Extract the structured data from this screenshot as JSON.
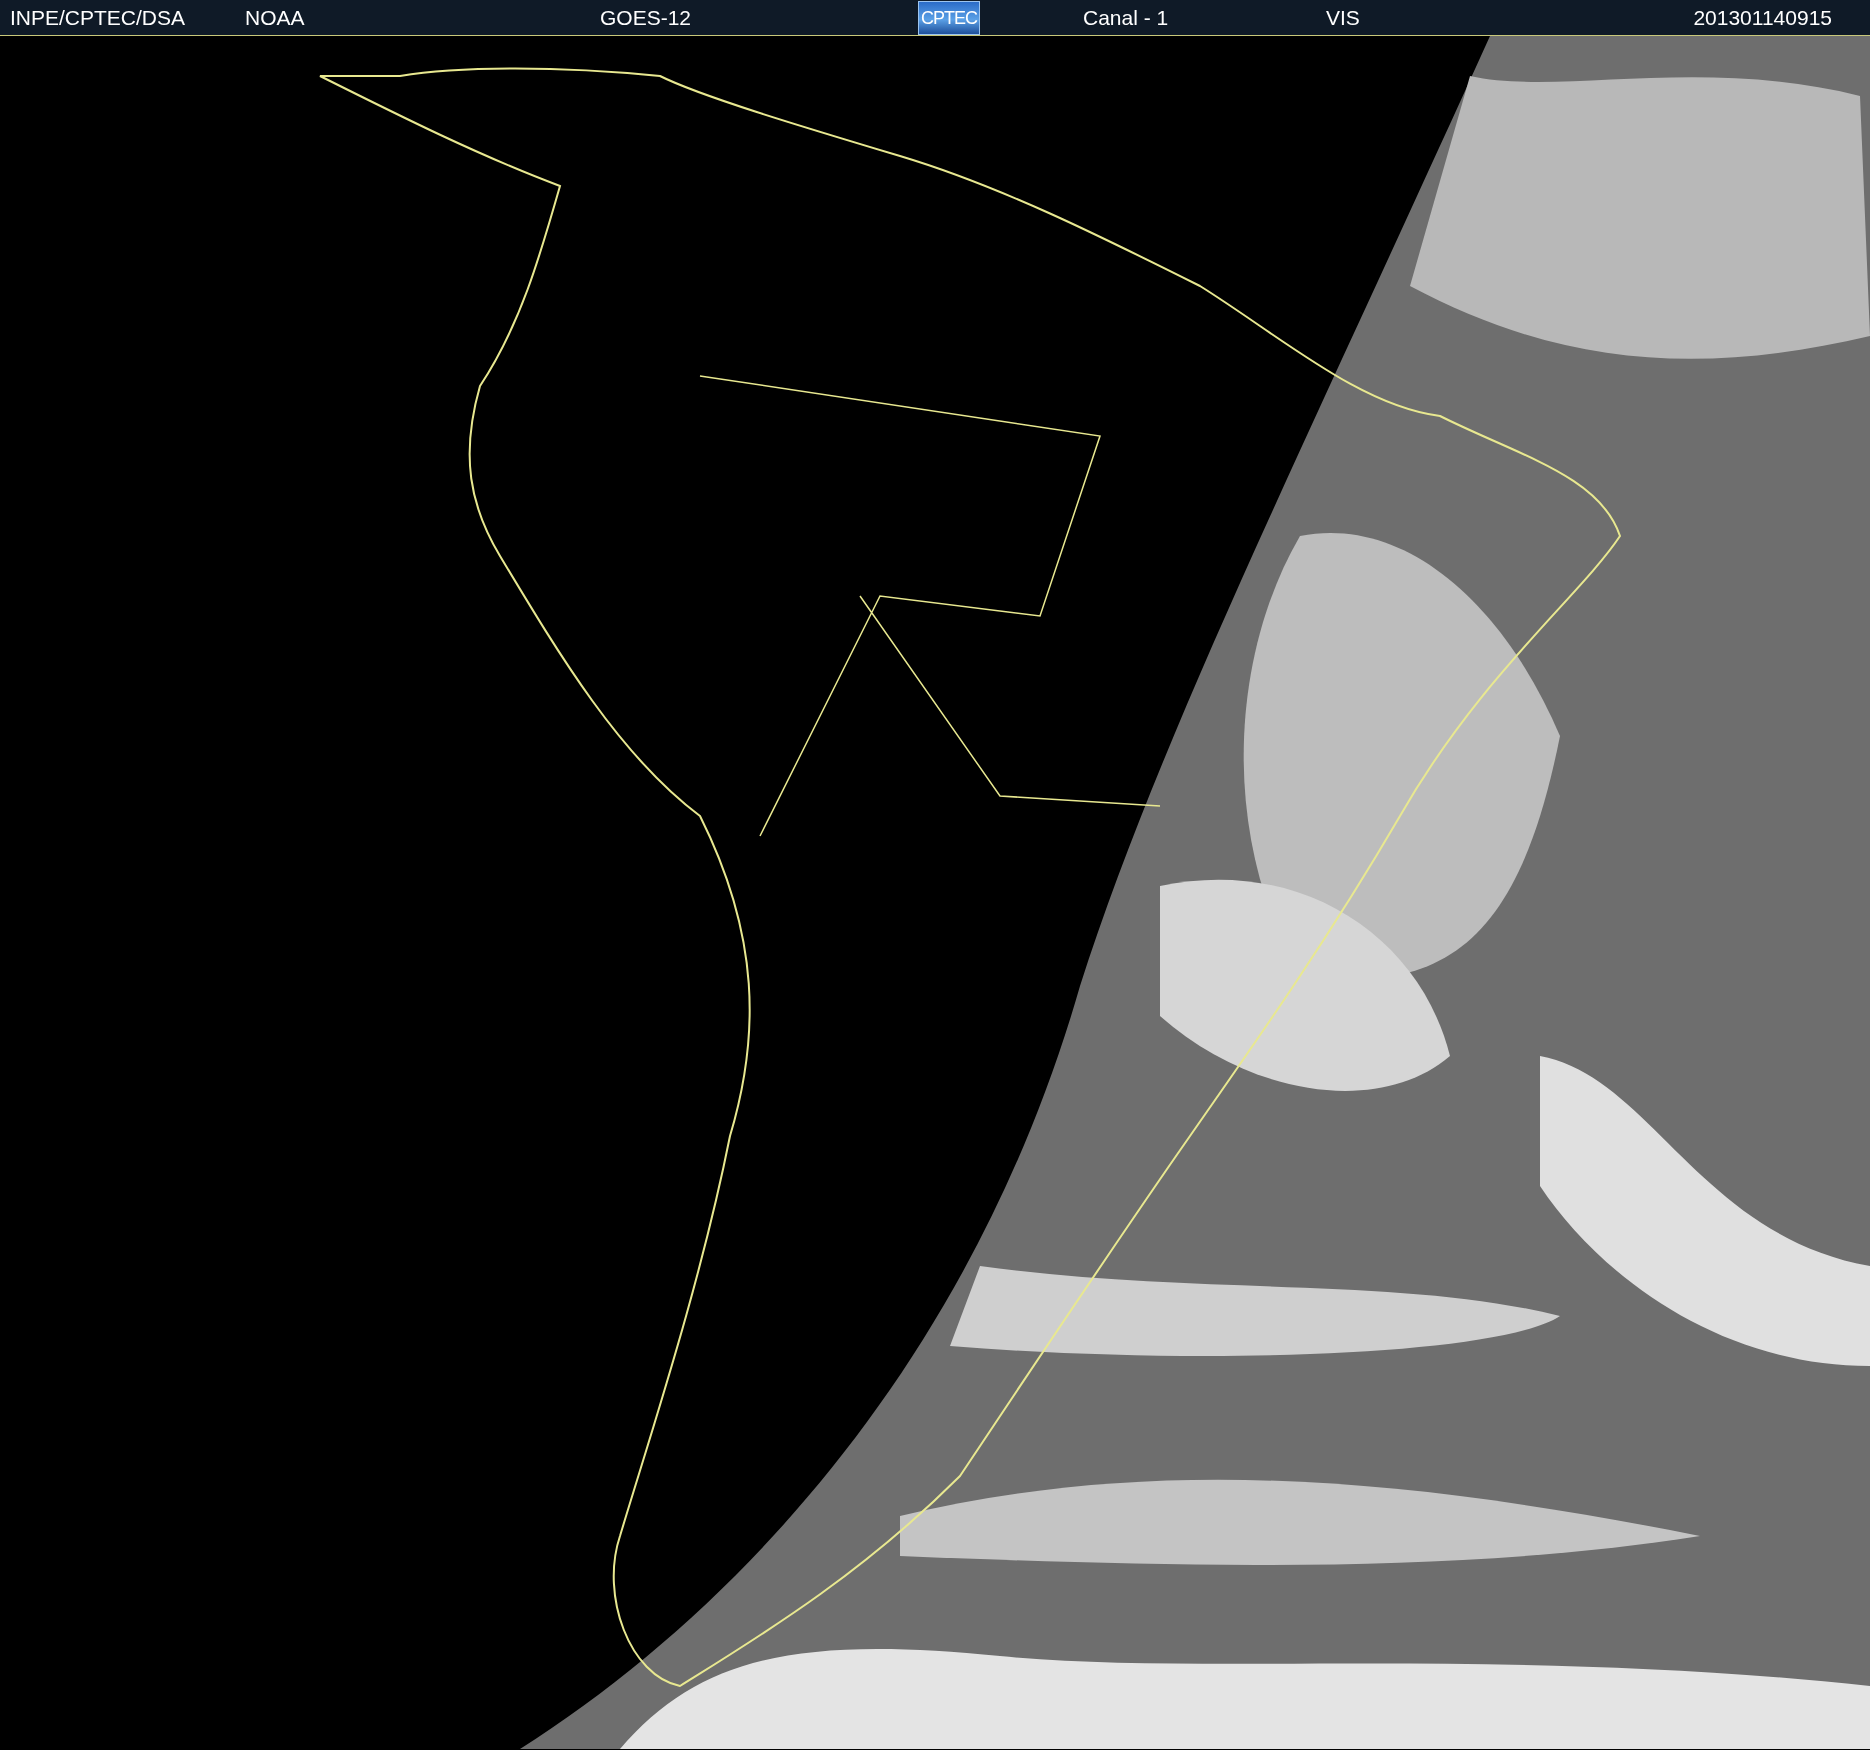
{
  "header": {
    "items": [
      {
        "kind": "text",
        "text": "INPE/CPTEC/DSA"
      },
      {
        "kind": "text",
        "text": "NOAA"
      },
      {
        "kind": "text",
        "text": "GOES-12"
      },
      {
        "kind": "logo",
        "text": "CPTEC"
      },
      {
        "kind": "text",
        "text": "Canal - 1"
      },
      {
        "kind": "text",
        "text": "VIS"
      },
      {
        "kind": "text",
        "text": "201301140915"
      }
    ]
  }
}
